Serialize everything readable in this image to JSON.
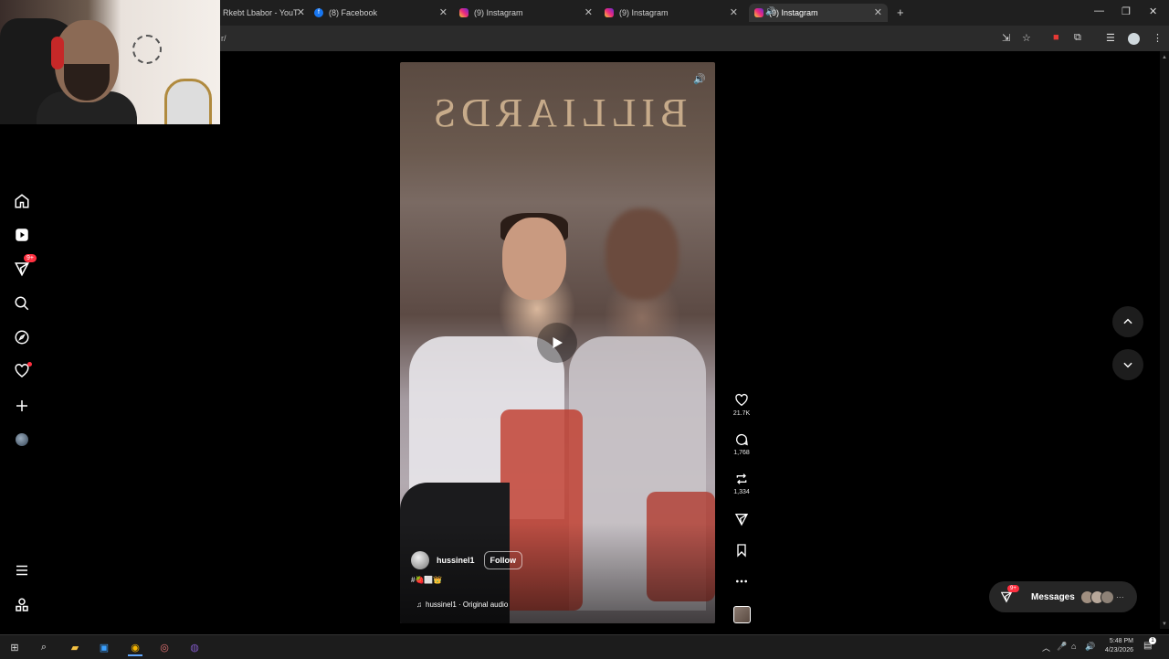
{
  "browser": {
    "tabs": [
      {
        "title": "Rkebt Lbabor - YouT",
        "favicon": "youtube-favicon",
        "active": false
      },
      {
        "title": "(8) Facebook",
        "favicon": "facebook-favicon",
        "active": false
      },
      {
        "title": "(9) Instagram",
        "favicon": "instagram-favicon",
        "active": false
      },
      {
        "title": "(9) Instagram",
        "favicon": "instagram-favicon",
        "active": false
      },
      {
        "title": "(9) Instagram",
        "favicon": "instagram-favicon",
        "active": true
      }
    ],
    "new_tab": "+",
    "address": "r/",
    "window_controls": {
      "minimize": "—",
      "maximize": "❐",
      "close": "✕"
    }
  },
  "nav": {
    "items": [
      {
        "name": "home",
        "icon": "home-icon"
      },
      {
        "name": "reels",
        "icon": "reels-icon"
      },
      {
        "name": "direct",
        "icon": "direct-icon",
        "badge": "9+"
      },
      {
        "name": "search",
        "icon": "search-icon"
      },
      {
        "name": "explore",
        "icon": "explore-icon"
      },
      {
        "name": "notifications",
        "icon": "heart-icon",
        "dot": true
      },
      {
        "name": "create",
        "icon": "plus-icon"
      },
      {
        "name": "profile",
        "icon": "profile-avatar"
      },
      {
        "name": "more",
        "icon": "menu-icon"
      },
      {
        "name": "threads",
        "icon": "apps-icon"
      }
    ],
    "direct_badge": "9+"
  },
  "reel": {
    "sign_text": "BILLIARDS",
    "owner": {
      "username": "hussinel1",
      "follow_label": "Follow"
    },
    "caption": "#🍓⬜👑",
    "audio": "hussinel1 · Original audio",
    "muted": false
  },
  "actions": {
    "likes": "21.7K",
    "comments": "1,768",
    "reposts": "1,334"
  },
  "messages": {
    "label": "Messages",
    "badge": "9+",
    "more": "···"
  },
  "taskbar": {
    "time": "5:48 PM",
    "date": "4/23/2026"
  },
  "colors": {
    "notification": "#ff3040",
    "background": "#000000"
  }
}
